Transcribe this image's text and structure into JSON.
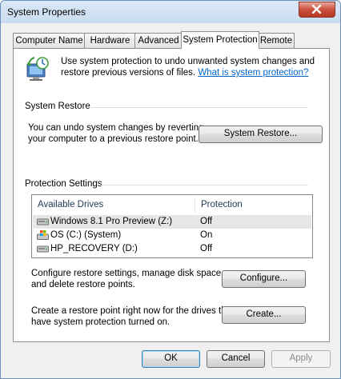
{
  "window": {
    "title": "System Properties"
  },
  "tabs": [
    {
      "label": "Computer Name"
    },
    {
      "label": "Hardware"
    },
    {
      "label": "Advanced"
    },
    {
      "label": "System Protection",
      "active": true
    },
    {
      "label": "Remote"
    }
  ],
  "intro": {
    "text_line1": "Use system protection to undo unwanted system changes and",
    "text_line2": "restore previous versions of files.",
    "link": "What is system protection?"
  },
  "system_restore": {
    "heading": "System Restore",
    "desc_line1": "You can undo system changes by reverting",
    "desc_line2": "your computer to a previous restore point.",
    "button": "System Restore..."
  },
  "protection": {
    "heading": "Protection Settings",
    "columns": [
      "Available Drives",
      "Protection"
    ],
    "drives": [
      {
        "name": "Windows 8.1 Pro Preview (Z:)",
        "protection": "Off",
        "icon": "drive-icon",
        "selected": true
      },
      {
        "name": "OS (C:) (System)",
        "protection": "On",
        "icon": "system-drive-icon"
      },
      {
        "name": "HP_RECOVERY (D:)",
        "protection": "Off",
        "icon": "drive-icon"
      }
    ],
    "configure_line1": "Configure restore settings, manage disk space,",
    "configure_line2": "and delete restore points.",
    "configure_button": "Configure...",
    "create_line1": "Create a restore point right now for the drives that",
    "create_line2": "have system protection turned on.",
    "create_button": "Create..."
  },
  "footer": {
    "ok": "OK",
    "cancel": "Cancel",
    "apply": "Apply"
  }
}
